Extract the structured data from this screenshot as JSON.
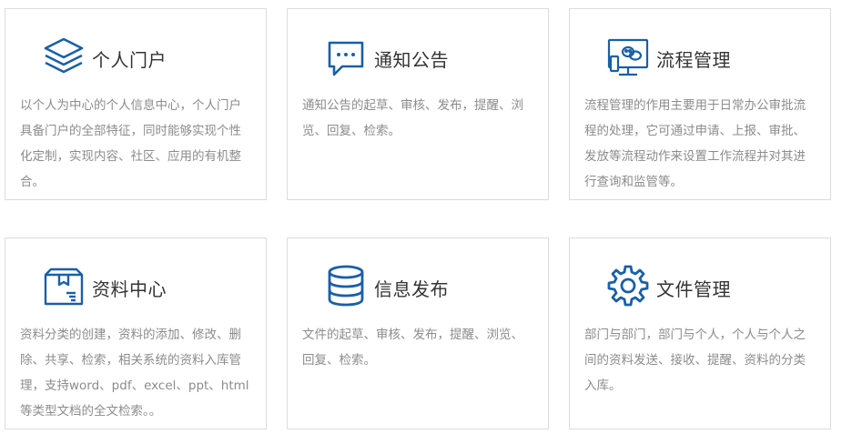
{
  "cards": [
    {
      "icon": "layers-icon",
      "title": "个人门户",
      "desc": "以个人为中心的个人信息中心，个人门户具备门户的全部特征，同时能够实现个性化定制，实现内容、社区、应用的有机整合。"
    },
    {
      "icon": "chat-bubble-icon",
      "title": "通知公告",
      "desc": "通知公告的起草、审核、发布，提醒、浏览、回复、检索。"
    },
    {
      "icon": "monitor-chat-icon",
      "title": "流程管理",
      "desc": "流程管理的作用主要用于日常办公审批流程的处理，它可通过申请、上报、审批、发放等流程动作来设置工作流程并对其进行查询和监管等。"
    },
    {
      "icon": "archive-box-icon",
      "title": "资料中心",
      "desc": "资料分类的创建，资料的添加、修改、删除、共享、检索，相关系统的资料入库管理，支持word、pdf、excel、ppt、html等类型文档的全文检索。。"
    },
    {
      "icon": "database-icon",
      "title": "信息发布",
      "desc": "文件的起草、审核、发布，提醒、浏览、回复、检索。"
    },
    {
      "icon": "gear-icon",
      "title": "文件管理",
      "desc": "部门与部门，部门与个人，个人与个人之间的资料发送、接收、提醒、资料的分类入库。"
    }
  ],
  "colors": {
    "accent": "#1a5fa8",
    "title": "#333333",
    "desc": "#8c8c8c",
    "border": "#dcdcdc"
  }
}
